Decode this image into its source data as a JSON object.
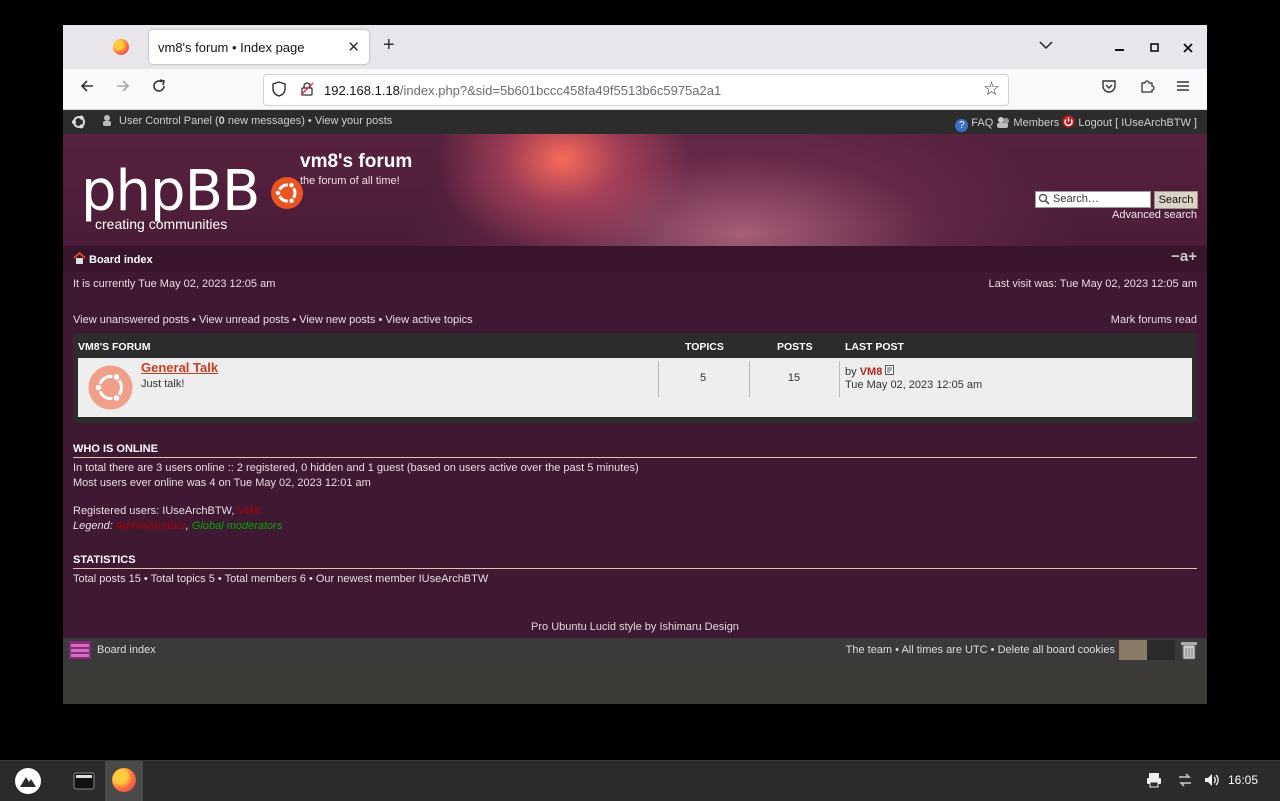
{
  "browser": {
    "tab_title": "vm8's forum • Index page",
    "tab_close": "✕",
    "new_tab": "+",
    "url_host": "192.168.1.18",
    "url_rest": "/index.php?&sid=5b601bccc458fa49f5513b6c5975a2a1"
  },
  "topnav": {
    "ucp_prefix": "User Control Panel (",
    "ucp_count": "0",
    "ucp_suffix": " new messages) • View your posts",
    "faq": "FAQ",
    "members": "Members",
    "logout": "Logout [ IUseArchBTW ]"
  },
  "header": {
    "logo_text": "phpBB",
    "logo_tagline": "creating  communities",
    "site_title": "vm8's forum",
    "site_desc": "the forum of all time!",
    "search_placeholder": "Search…",
    "search_button": "Search",
    "advanced_search": "Advanced search"
  },
  "breadcrumb": {
    "home": "Board index",
    "font_size_control": "−a+"
  },
  "info": {
    "current_time": "It is currently Tue May 02, 2023 12:05 am",
    "last_visit": "Last visit was: Tue May 02, 2023 12:05 am",
    "quick_links": "View unanswered posts • View unread posts • View new posts • View active topics",
    "mark_read": "Mark forums read"
  },
  "forum_table": {
    "headers": {
      "forum": "VM8'S FORUM",
      "topics": "TOPICS",
      "posts": "POSTS",
      "last_post": "LAST POST"
    },
    "row": {
      "title": "General Talk",
      "desc": "Just talk!",
      "topics": "5",
      "posts": "15",
      "last_by_prefix": "by",
      "last_by_user": "VM8",
      "last_time": "Tue May 02, 2023 12:05 am"
    }
  },
  "who_is_online": {
    "title": "WHO IS ONLINE",
    "line1": "In total there are 3 users online :: 2 registered, 0 hidden and 1 guest (based on users active over the past 5 minutes)",
    "line2": "Most users ever online was 4 on Tue May 02, 2023 12:01 am",
    "registered_prefix": "Registered users: IUseArchBTW, ",
    "registered_admin": "VM8",
    "legend_prefix": "Legend: ",
    "legend_admins": "Administrators",
    "legend_sep": ", ",
    "legend_mods": "Global moderators"
  },
  "statistics": {
    "title": "STATISTICS",
    "line": "Total posts 15 • Total topics 5 • Total members 6 • Our newest member IUseArchBTW"
  },
  "footer": {
    "credit": "Pro Ubuntu Lucid style by Ishimaru Design",
    "board_index": "Board index",
    "right_links": "The team • All times are UTC • Delete all board cookies"
  },
  "taskbar": {
    "clock": "16:05"
  },
  "colors": {
    "forum_bg": "#3f1833",
    "accent_orange": "#e95420",
    "admin_red": "#aa0000",
    "mod_green": "#00aa00"
  }
}
